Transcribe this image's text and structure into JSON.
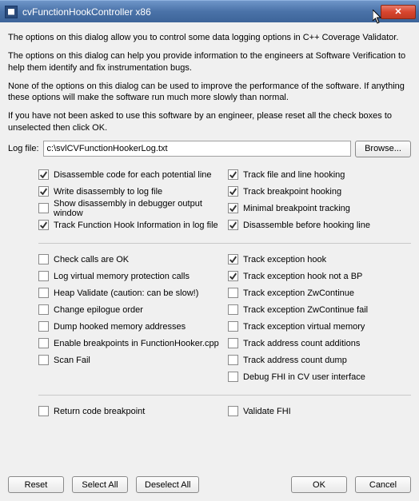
{
  "window": {
    "title": "cvFunctionHookController x86",
    "close_icon": "✕"
  },
  "intro": {
    "p1": "The options on this dialog allow you to control some data logging options in C++ Coverage Validator.",
    "p2": "The options on this dialog can help you provide information to the engineers at Software Verification to help them identify and fix instrumentation bugs.",
    "p3": "None of the options on this dialog can be used to improve the performance of the software. If anything these options will make the software run much more slowly than normal.",
    "p4": "If you have not been asked to use this software by an engineer, please reset all the check boxes to unselected then click OK."
  },
  "logfile": {
    "label": "Log file:",
    "value": "c:\\svlCVFunctionHookerLog.txt",
    "browse": "Browse..."
  },
  "group1": {
    "left": [
      {
        "label": "Disassemble code for each potential line",
        "checked": true
      },
      {
        "label": "Write disassembly to log file",
        "checked": true
      },
      {
        "label": "Show disassembly in debugger output window",
        "checked": false
      },
      {
        "label": "Track Function Hook Information in log file",
        "checked": true
      }
    ],
    "right": [
      {
        "label": "Track file and line hooking",
        "checked": true
      },
      {
        "label": "Track breakpoint hooking",
        "checked": true
      },
      {
        "label": "Minimal breakpoint tracking",
        "checked": true
      },
      {
        "label": "Disassemble before hooking line",
        "checked": true
      }
    ]
  },
  "group2": {
    "left": [
      {
        "label": "Check calls are OK",
        "checked": false
      },
      {
        "label": "Log virtual memory protection calls",
        "checked": false
      },
      {
        "label": "Heap Validate (caution: can be slow!)",
        "checked": false
      },
      {
        "label": "Change epilogue order",
        "checked": false
      },
      {
        "label": "Dump hooked memory addresses",
        "checked": false
      },
      {
        "label": "Enable breakpoints in FunctionHooker.cpp",
        "checked": false
      },
      {
        "label": "Scan Fail",
        "checked": false
      }
    ],
    "right": [
      {
        "label": "Track exception hook",
        "checked": true
      },
      {
        "label": "Track exception hook not a BP",
        "checked": true
      },
      {
        "label": "Track exception ZwContinue",
        "checked": false
      },
      {
        "label": "Track exception ZwContinue fail",
        "checked": false
      },
      {
        "label": "Track exception virtual memory",
        "checked": false
      },
      {
        "label": "Track address count additions",
        "checked": false
      },
      {
        "label": "Track address count dump",
        "checked": false
      },
      {
        "label": "Debug FHI in CV user interface",
        "checked": false
      }
    ]
  },
  "group3": {
    "left": [
      {
        "label": "Return code breakpoint",
        "checked": false
      }
    ],
    "right": [
      {
        "label": "Validate FHI",
        "checked": false
      }
    ]
  },
  "buttons": {
    "reset": "Reset",
    "select_all": "Select All",
    "deselect_all": "Deselect All",
    "ok": "OK",
    "cancel": "Cancel"
  }
}
